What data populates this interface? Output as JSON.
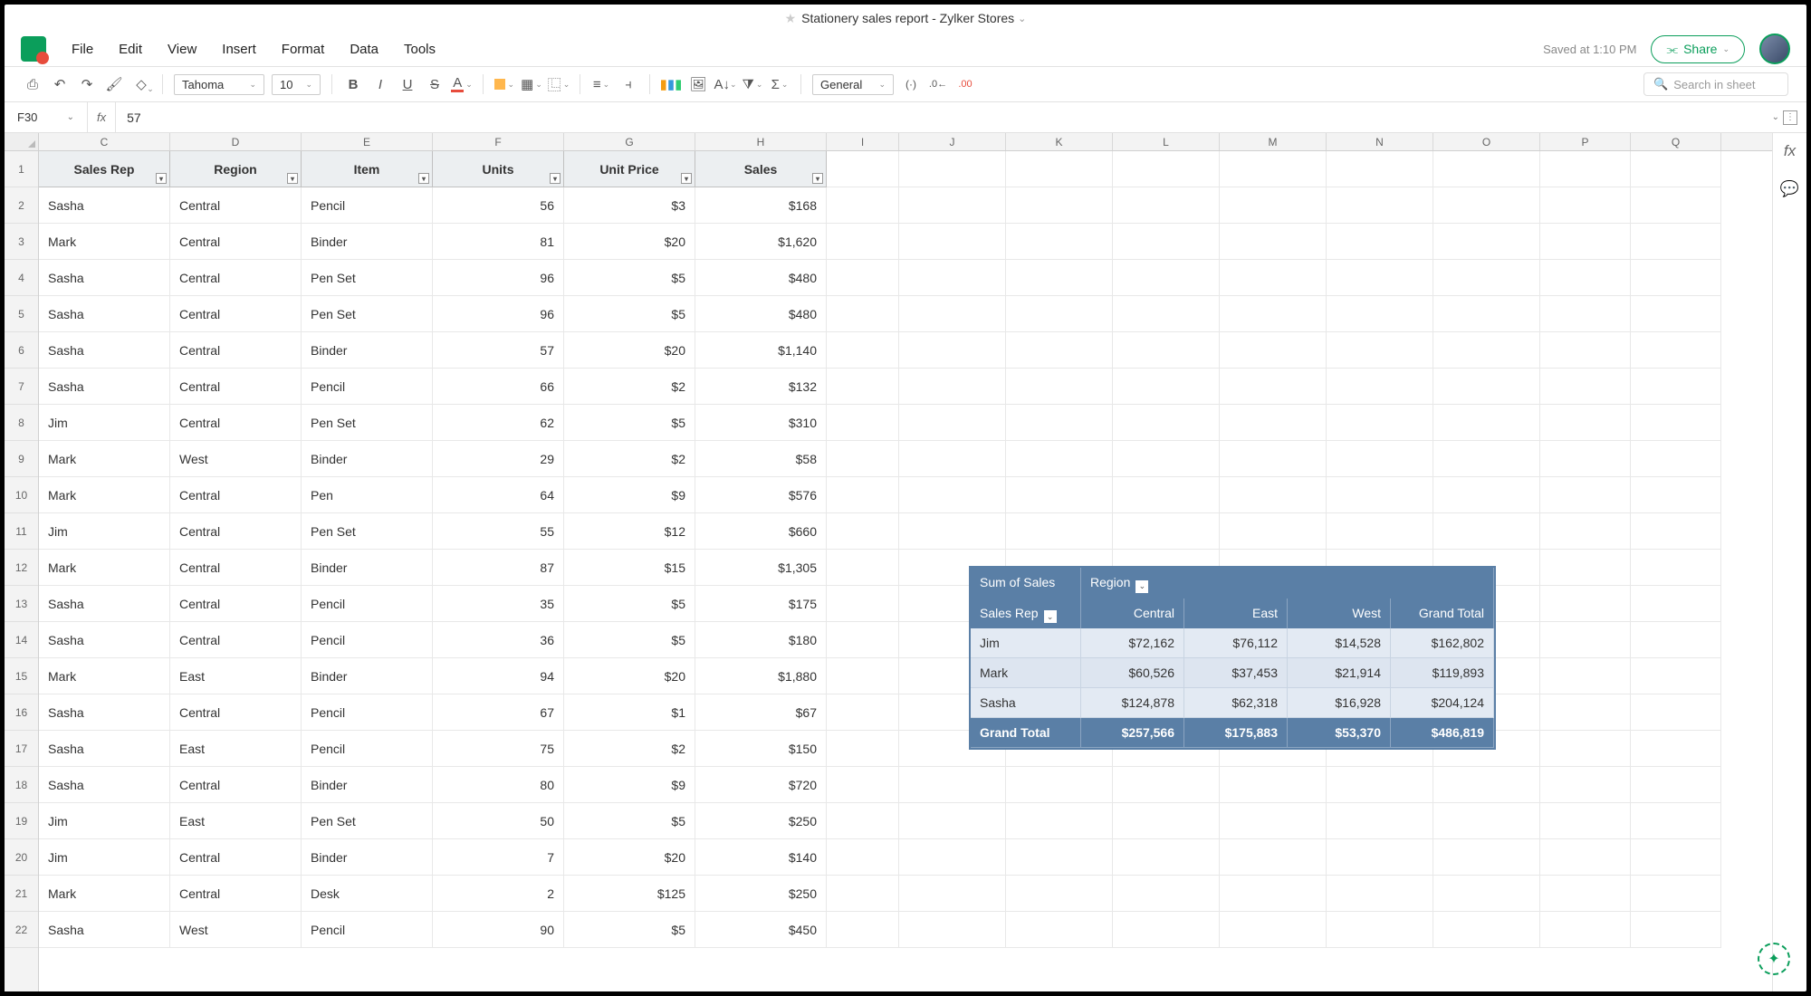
{
  "title": "Stationery sales report - Zylker Stores",
  "saved": "Saved at 1:10 PM",
  "share_label": "Share",
  "menus": [
    "File",
    "Edit",
    "View",
    "Insert",
    "Format",
    "Data",
    "Tools"
  ],
  "font_family": "Tahoma",
  "font_size": "10",
  "number_format": "General",
  "search_placeholder": "Search in sheet",
  "cell_ref": "F30",
  "formula_value": "57",
  "col_widths": {
    "C": 145,
    "D": 145,
    "E": 145,
    "F": 145,
    "G": 145,
    "H": 145,
    "I": 80,
    "J": 118,
    "K": 118,
    "L": 118,
    "M": 118,
    "N": 118,
    "O": 118,
    "P": 100,
    "Q": 100
  },
  "columns": [
    "C",
    "D",
    "E",
    "F",
    "G",
    "H",
    "I",
    "J",
    "K",
    "L",
    "M",
    "N",
    "O",
    "P",
    "Q"
  ],
  "headers": [
    "Sales Rep",
    "Region",
    "Item",
    "Units",
    "Unit Price",
    "Sales"
  ],
  "rows": [
    [
      "Sasha",
      "Central",
      "Pencil",
      "56",
      "$3",
      "$168"
    ],
    [
      "Mark",
      "Central",
      "Binder",
      "81",
      "$20",
      "$1,620"
    ],
    [
      "Sasha",
      "Central",
      "Pen Set",
      "96",
      "$5",
      "$480"
    ],
    [
      "Sasha",
      "Central",
      "Pen Set",
      "96",
      "$5",
      "$480"
    ],
    [
      "Sasha",
      "Central",
      "Binder",
      "57",
      "$20",
      "$1,140"
    ],
    [
      "Sasha",
      "Central",
      "Pencil",
      "66",
      "$2",
      "$132"
    ],
    [
      "Jim",
      "Central",
      "Pen Set",
      "62",
      "$5",
      "$310"
    ],
    [
      "Mark",
      "West",
      "Binder",
      "29",
      "$2",
      "$58"
    ],
    [
      "Mark",
      "Central",
      "Pen",
      "64",
      "$9",
      "$576"
    ],
    [
      "Jim",
      "Central",
      "Pen Set",
      "55",
      "$12",
      "$660"
    ],
    [
      "Mark",
      "Central",
      "Binder",
      "87",
      "$15",
      "$1,305"
    ],
    [
      "Sasha",
      "Central",
      "Pencil",
      "35",
      "$5",
      "$175"
    ],
    [
      "Sasha",
      "Central",
      "Pencil",
      "36",
      "$5",
      "$180"
    ],
    [
      "Mark",
      "East",
      "Binder",
      "94",
      "$20",
      "$1,880"
    ],
    [
      "Sasha",
      "Central",
      "Pencil",
      "67",
      "$1",
      "$67"
    ],
    [
      "Sasha",
      "East",
      "Pencil",
      "75",
      "$2",
      "$150"
    ],
    [
      "Sasha",
      "Central",
      "Binder",
      "80",
      "$9",
      "$720"
    ],
    [
      "Jim",
      "East",
      "Pen Set",
      "50",
      "$5",
      "$250"
    ],
    [
      "Jim",
      "Central",
      "Binder",
      "7",
      "$20",
      "$140"
    ],
    [
      "Mark",
      "Central",
      "Desk",
      "2",
      "$125",
      "$250"
    ],
    [
      "Sasha",
      "West",
      "Pencil",
      "90",
      "$5",
      "$450"
    ]
  ],
  "pivot": {
    "title": "Sum of Sales",
    "col_field": "Region",
    "row_field": "Sales Rep",
    "regions": [
      "Central",
      "East",
      "West",
      "Grand Total"
    ],
    "data": [
      {
        "rep": "Jim",
        "vals": [
          "$72,162",
          "$76,112",
          "$14,528",
          "$162,802"
        ]
      },
      {
        "rep": "Mark",
        "vals": [
          "$60,526",
          "$37,453",
          "$21,914",
          "$119,893"
        ]
      },
      {
        "rep": "Sasha",
        "vals": [
          "$124,878",
          "$62,318",
          "$16,928",
          "$204,124"
        ]
      }
    ],
    "grand_total": {
      "label": "Grand Total",
      "vals": [
        "$257,566",
        "$175,883",
        "$53,370",
        "$486,819"
      ]
    }
  }
}
